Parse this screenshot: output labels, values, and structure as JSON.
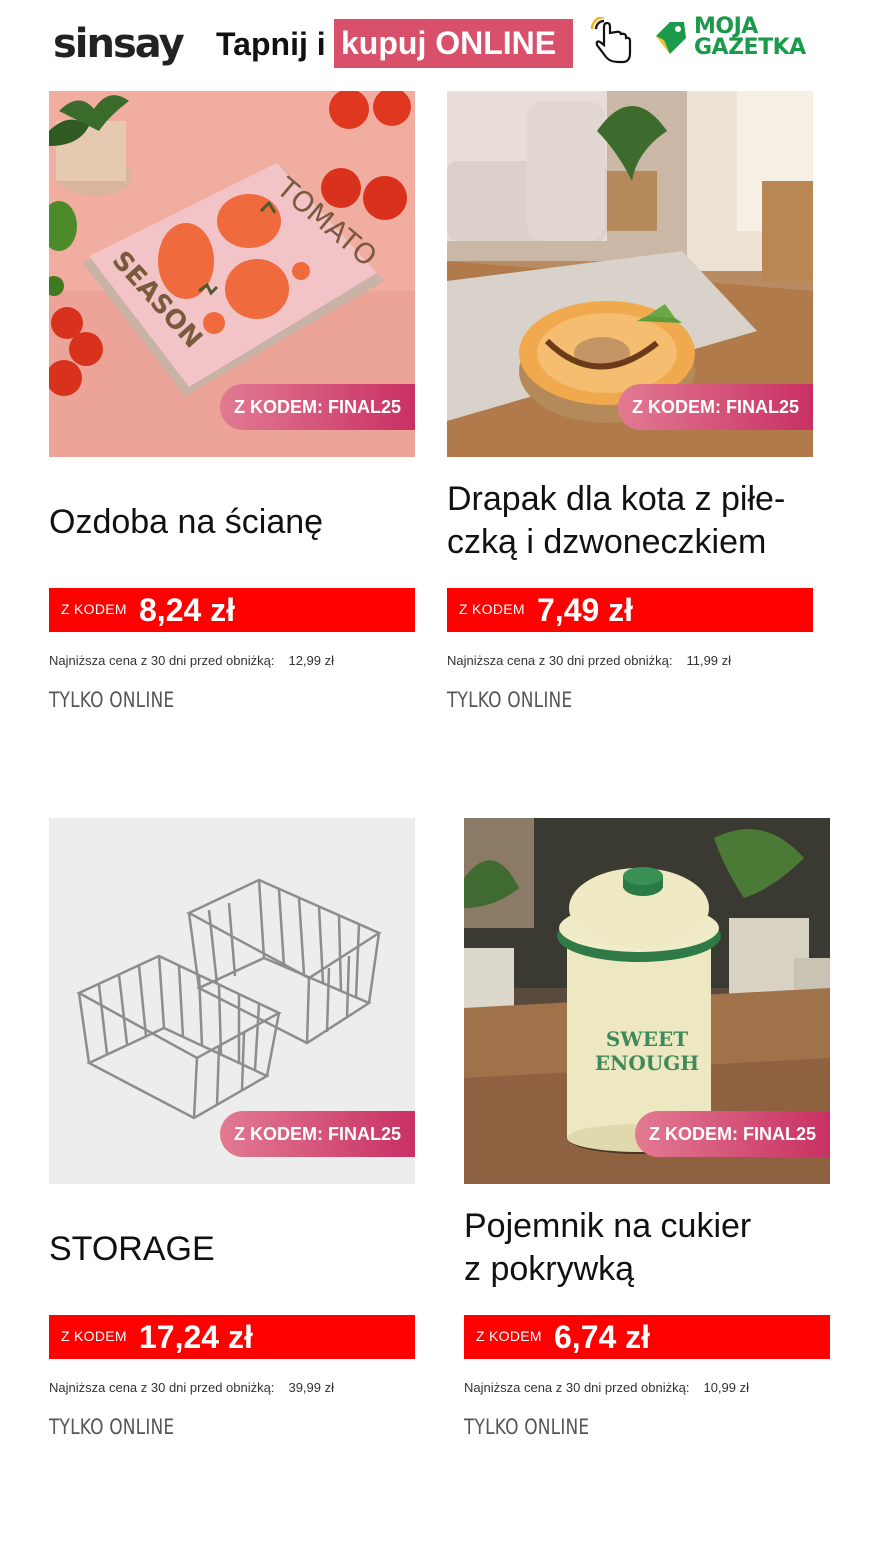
{
  "header": {
    "brand": "sinsay",
    "tap_text": "Tapnij i",
    "tap_highlight": "kupuj ONLINE",
    "partner_line1": "MOJA",
    "partner_line2": "GAZETKA",
    "icons": [
      "tap-hand-icon",
      "moja-gazetka-logo"
    ]
  },
  "colors": {
    "price_bg": "#ff0000",
    "promo_start": "#e27a92",
    "promo_end": "#c83063",
    "highlight": "#d9506b",
    "partner_green": "#1b9a4b"
  },
  "products": [
    {
      "promo": "Z KODEM: FINAL25",
      "title": "Ozdoba na ścianę",
      "code_label": "Z KODEM",
      "price": "8,24 zł",
      "lowest_label": "Najniższa cena z 30 dni przed obniżką:",
      "lowest_value": "12,99 zł",
      "availability": "TYLKO ONLINE",
      "image_text_1": "TOMATO",
      "image_text_2": "SEASON"
    },
    {
      "promo": "Z KODEM: FINAL25",
      "title_line1": "Drapak dla kota z piłe-",
      "title_line2": "czką i dzwoneczkiem",
      "code_label": "Z KODEM",
      "price": "7,49 zł",
      "lowest_label": "Najniższa cena z 30 dni przed obniżką:",
      "lowest_value": "11,99 zł",
      "availability": "TYLKO ONLINE"
    },
    {
      "promo": "Z KODEM: FINAL25",
      "title": "STORAGE",
      "code_label": "Z KODEM",
      "price": "17,24 zł",
      "lowest_label": "Najniższa cena z 30 dni przed obniżką:",
      "lowest_value": "39,99 zł",
      "availability": "TYLKO ONLINE"
    },
    {
      "promo": "Z KODEM: FINAL25",
      "title_line1": "Pojemnik na cukier",
      "title_line2": "z pokrywką",
      "code_label": "Z KODEM",
      "price": "6,74 zł",
      "lowest_label": "Najniższa cena z 30 dni przed obniżką:",
      "lowest_value": "10,99 zł",
      "availability": "TYLKO ONLINE",
      "image_text_1": "SWEET",
      "image_text_2": "ENOUGH"
    }
  ]
}
